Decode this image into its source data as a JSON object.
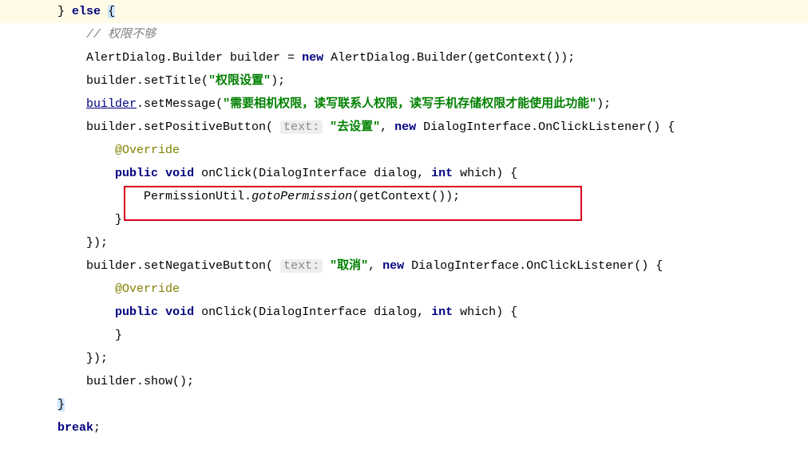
{
  "code": {
    "l1_kw_else": "else",
    "l2_comment": "// 权限不够",
    "l3_a": "            AlertDialog.Builder builder = ",
    "l3_kw_new": "new",
    "l3_b": " AlertDialog.Builder(getContext());",
    "l4_a": "            builder.setTitle(",
    "l4_str": "\"权限设置\"",
    "l4_b": ");",
    "l5_builder": "builder",
    "l5_a": ".setMessage(",
    "l5_str": "\"需要相机权限，读写联系人权限，读写手机存储权限才能使用此功能\"",
    "l5_b": ");",
    "l6_a": "            builder.setPositiveButton( ",
    "l6_hint": "text:",
    "l6_str": "\"去设置\"",
    "l6_b": ", ",
    "l6_kw_new": "new",
    "l6_c": " DialogInterface.OnClickListener() {",
    "l7_override": "@Override",
    "l8_kw_public": "public",
    "l8_kw_void": "void",
    "l8_m": " onClick(DialogInterface dialog, ",
    "l8_kw_int": "int",
    "l8_p": " which) {",
    "l9_a": "                    PermissionUtil.",
    "l9_ital": "gotoPermission",
    "l9_b": "(getContext());",
    "l12_a": "            builder.setNegativeButton( ",
    "l12_hint": "text:",
    "l12_str": "\"取消\"",
    "l12_b": ", ",
    "l12_kw_new": "new",
    "l12_c": " DialogInterface.OnClickListener() {",
    "l13_override": "@Override",
    "l14_kw_public": "public",
    "l14_kw_void": "void",
    "l14_m": " onClick(DialogInterface dialog, ",
    "l14_kw_int": "int",
    "l14_p": " which) {",
    "l17_show": "            builder.show();",
    "l19_kw_break": "break"
  },
  "braces": {
    "open": "{",
    "close": "}",
    "close_paren_semi": "});",
    "close_paren_sp": "} ",
    "close_sp": "}",
    "semi": ";"
  },
  "indent": {
    "i8": "        ",
    "i12": "            ",
    "i16": "                ",
    "i20": "                    "
  }
}
